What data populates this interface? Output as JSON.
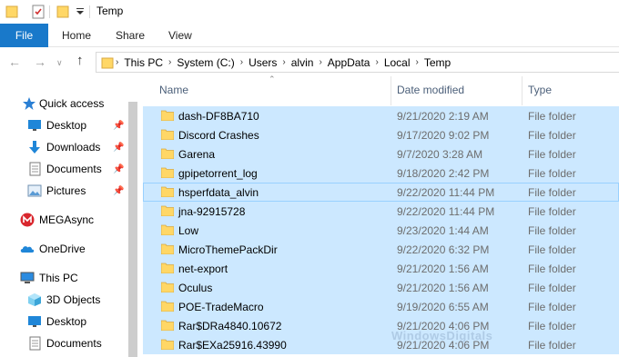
{
  "window": {
    "title": "Temp"
  },
  "ribbon": {
    "file_tab": "File",
    "tabs": [
      "Home",
      "Share",
      "View"
    ]
  },
  "address": {
    "crumbs": [
      "This PC",
      "System (C:)",
      "Users",
      "alvin",
      "AppData",
      "Local",
      "Temp"
    ]
  },
  "sidebar": {
    "items": [
      {
        "label": "Quick access",
        "icon": "star-icon"
      },
      {
        "label": "Desktop",
        "icon": "desktop-icon",
        "pinned": true
      },
      {
        "label": "Downloads",
        "icon": "download-icon",
        "pinned": true
      },
      {
        "label": "Documents",
        "icon": "documents-icon",
        "pinned": true
      },
      {
        "label": "Pictures",
        "icon": "pictures-icon",
        "pinned": true
      },
      {
        "label": "MEGAsync",
        "icon": "mega-icon"
      },
      {
        "label": "OneDrive",
        "icon": "cloud-icon"
      },
      {
        "label": "This PC",
        "icon": "computer-icon"
      },
      {
        "label": "3D Objects",
        "icon": "cube-icon"
      },
      {
        "label": "Desktop",
        "icon": "desktop-icon"
      },
      {
        "label": "Documents",
        "icon": "documents-icon"
      }
    ]
  },
  "list": {
    "columns": {
      "name": "Name",
      "date": "Date modified",
      "type": "Type"
    },
    "rows": [
      {
        "name": "dash-DF8BA710",
        "date": "9/21/2020 2:19 AM",
        "type": "File folder"
      },
      {
        "name": "Discord Crashes",
        "date": "9/17/2020 9:02 PM",
        "type": "File folder"
      },
      {
        "name": "Garena",
        "date": "9/7/2020 3:28 AM",
        "type": "File folder"
      },
      {
        "name": "gpipetorrent_log",
        "date": "9/18/2020 2:42 PM",
        "type": "File folder"
      },
      {
        "name": "hsperfdata_alvin",
        "date": "9/22/2020 11:44 PM",
        "type": "File folder"
      },
      {
        "name": "jna-92915728",
        "date": "9/22/2020 11:44 PM",
        "type": "File folder"
      },
      {
        "name": "Low",
        "date": "9/23/2020 1:44 AM",
        "type": "File folder"
      },
      {
        "name": "MicroThemePackDir",
        "date": "9/22/2020 6:32 PM",
        "type": "File folder"
      },
      {
        "name": "net-export",
        "date": "9/21/2020 1:56 AM",
        "type": "File folder"
      },
      {
        "name": "Oculus",
        "date": "9/21/2020 1:56 AM",
        "type": "File folder"
      },
      {
        "name": "POE-TradeMacro",
        "date": "9/19/2020 6:55 AM",
        "type": "File folder"
      },
      {
        "name": "Rar$DRa4840.10672",
        "date": "9/21/2020 4:06 PM",
        "type": "File folder"
      },
      {
        "name": "Rar$EXa25916.43990",
        "date": "9/21/2020 4:06 PM",
        "type": "File folder"
      }
    ]
  },
  "watermark": "WindowsDigitals",
  "colors": {
    "accent": "#1979ca",
    "selection": "#cce8ff",
    "folder": "#ffd766"
  }
}
